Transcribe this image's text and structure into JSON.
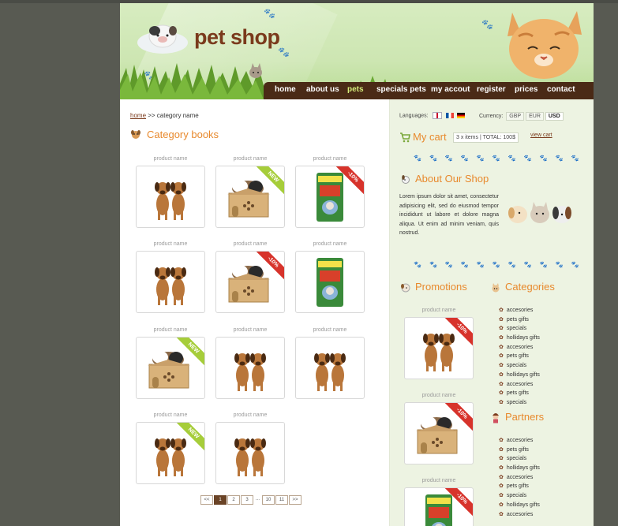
{
  "header": {
    "logo": "pet shop",
    "nav": [
      {
        "label": "home",
        "active": false
      },
      {
        "label": "about us",
        "active": false
      },
      {
        "label": "pets",
        "active": true
      },
      {
        "label": "specials pets",
        "active": false
      },
      {
        "label": "my accout",
        "active": false
      },
      {
        "label": "register",
        "active": false
      },
      {
        "label": "prices",
        "active": false
      },
      {
        "label": "contact",
        "active": false
      }
    ]
  },
  "breadcrumb": {
    "home": "home",
    "rest": " >> category name"
  },
  "category": {
    "title": "Category books",
    "products": [
      {
        "name": "product name",
        "img": "dogs",
        "badge": ""
      },
      {
        "name": "product name",
        "img": "hutch",
        "badge": "NEW"
      },
      {
        "name": "product name",
        "img": "food",
        "badge": "-10%"
      },
      {
        "name": "product name",
        "img": "dogs",
        "badge": ""
      },
      {
        "name": "product name",
        "img": "hutch",
        "badge": "-10%"
      },
      {
        "name": "product name",
        "img": "food",
        "badge": ""
      },
      {
        "name": "product name",
        "img": "hutch",
        "badge": "NEW"
      },
      {
        "name": "product name",
        "img": "dogs",
        "badge": ""
      },
      {
        "name": "product name",
        "img": "dogs",
        "badge": ""
      },
      {
        "name": "product name",
        "img": "dogs",
        "badge": "NEW"
      },
      {
        "name": "product name",
        "img": "dogs",
        "badge": ""
      }
    ]
  },
  "pagination": [
    "<<",
    "1",
    "2",
    "3",
    "...",
    "10",
    "11",
    ">>"
  ],
  "pagination_current": "1",
  "sidebar": {
    "languages_label": "Languages:",
    "currency_label": "Currency:",
    "currencies": [
      "GBP",
      "EUR",
      "USD"
    ],
    "currency_selected": "USD",
    "cart_title": "My cart",
    "cart_summary": "3 x items | TOTAL: 100$",
    "view_cart": "view cart",
    "about_title": "About Our Shop",
    "about_text": "Lorem ipsum dolor sit amet, consectetur adipisicing elit, sed do eiusmod tempor incididunt ut labore et dolore magna aliqua. Ut enim ad minim veniam, quis nostrud.",
    "promotions_title": "Promotions",
    "categories_title": "Categories",
    "categories": [
      "accesories",
      "pets gifts",
      "specials",
      "hollidays gifts",
      "accesories",
      "pets gifts",
      "specials",
      "hollidays gifts",
      "accesories",
      "pets gifts",
      "specials"
    ],
    "partners_title": "Partners",
    "partners": [
      "accesories",
      "pets gifts",
      "specials",
      "hollidays gifts",
      "accesories",
      "pets gifts",
      "specials",
      "hollidays gifts",
      "accesories"
    ],
    "promotions": [
      {
        "name": "product name",
        "img": "dogs",
        "badge": "-10%"
      },
      {
        "name": "product name",
        "img": "hutch",
        "badge": "-10%"
      },
      {
        "name": "product name",
        "img": "food",
        "badge": "-10%"
      }
    ]
  },
  "colors": {
    "accent": "#e8892d",
    "nav_bg": "#4a2a16",
    "brand": "#7a3a1c",
    "new_badge": "#a6cd3a",
    "sale_badge": "#d7332b"
  }
}
